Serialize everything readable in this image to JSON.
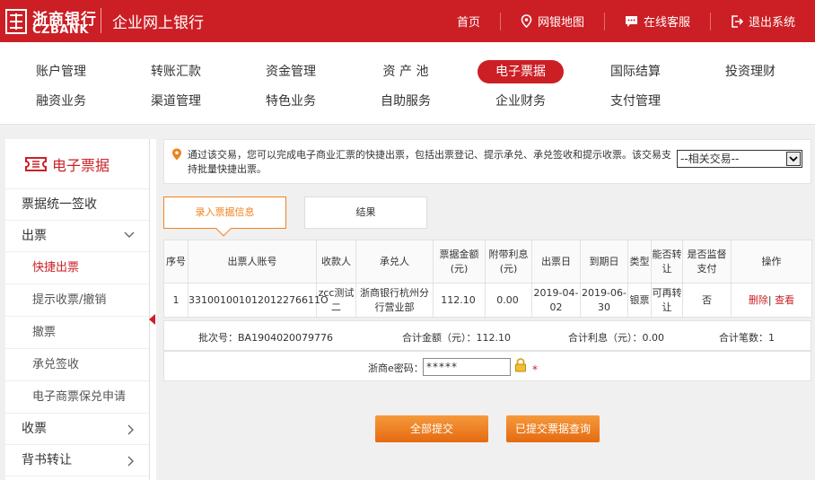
{
  "header": {
    "logo_cn": "浙商银行",
    "logo_en": "CZBANK",
    "system_title": "企业网上银行",
    "nav": [
      {
        "label": "首页"
      },
      {
        "label": "网银地图"
      },
      {
        "label": "在线客服"
      },
      {
        "label": "退出系统"
      }
    ]
  },
  "main_nav": [
    {
      "label": "账户管理"
    },
    {
      "label": "转账汇款"
    },
    {
      "label": "资金管理"
    },
    {
      "label": "资 产 池"
    },
    {
      "label": "电子票据",
      "active": true
    },
    {
      "label": "国际结算"
    },
    {
      "label": "投资理财"
    },
    {
      "label": "融资业务"
    },
    {
      "label": "渠道管理"
    },
    {
      "label": "特色业务"
    },
    {
      "label": "自助服务"
    },
    {
      "label": "企业财务"
    },
    {
      "label": "支付管理"
    }
  ],
  "sidebar": {
    "title": "电子票据",
    "items": [
      {
        "label": "票据统一签收"
      },
      {
        "label": "出票"
      },
      {
        "label": "快捷出票"
      },
      {
        "label": "提示收票/撤销"
      },
      {
        "label": "撤票"
      },
      {
        "label": "承兑签收"
      },
      {
        "label": "电子商票保兑申请"
      },
      {
        "label": "收票"
      },
      {
        "label": "背书转让"
      }
    ]
  },
  "notice": {
    "text": "通过该交易，您可以完成电子商业汇票的快捷出票，包括出票登记、提示承兑、承兑签收和提示收票。该交易支持批量快捷出票。",
    "related_select": "--相关交易--"
  },
  "tabs": [
    {
      "label": "录入票据信息",
      "active": true
    },
    {
      "label": "结果"
    }
  ],
  "table": {
    "headers": [
      "序号",
      "出票人账号",
      "收款人",
      "承兑人",
      "票据金额(元)",
      "附带利息(元)",
      "出票日",
      "到期日",
      "类型",
      "能否转让",
      "是否监督支付",
      "操作"
    ],
    "rows": [
      {
        "index": "1",
        "account": "331001001012012276611O",
        "payee": "zcc测试二",
        "acceptor": "浙商银行杭州分行营业部",
        "amount": "112.10",
        "interest": "0.00",
        "issue_date": "2019-04-02",
        "due_date": "2019-06-30",
        "type": "银票",
        "transferable": "可再转让",
        "supervised": "否",
        "op_delete": "删除",
        "op_sep": "|",
        "op_view": "查看"
      }
    ]
  },
  "summary": {
    "batch": "批次号：BA1904020079776",
    "total_amount": "合计金额（元）：112.10",
    "total_interest": "合计利息（元）：0.00",
    "total_count": "合计笔数：1"
  },
  "password": {
    "label": "浙商e密码：",
    "value": "*****",
    "required_mark": "*"
  },
  "buttons": {
    "submit_all": "全部提交",
    "query_submitted": "已提交票据查询"
  }
}
